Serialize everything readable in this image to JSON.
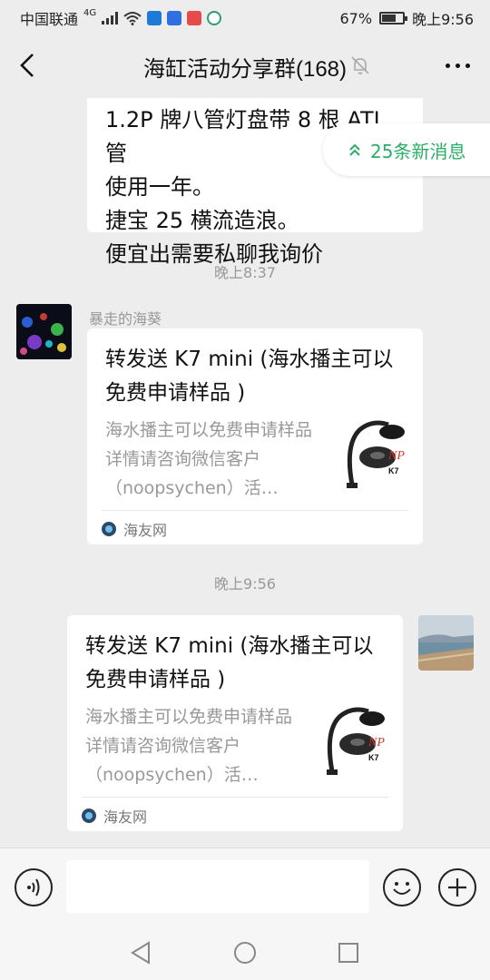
{
  "status_bar": {
    "carrier": "中国联通",
    "network": "4G",
    "battery": "67%",
    "time": "晚上9:56"
  },
  "header": {
    "title": "海缸活动分享群(168)"
  },
  "new_messages_pill": {
    "label": "25条新消息"
  },
  "messages": [
    {
      "type": "text",
      "lines": [
        "1.2P 牌八管灯盘带 8 根 ATI 管",
        "使用一年。",
        "捷宝 25 横流造浪。",
        "便宜出需要私聊我询价"
      ]
    },
    {
      "type": "timestamp",
      "text": "晚上8:37"
    },
    {
      "type": "link_card",
      "side": "left",
      "sender": "暴走的海葵",
      "title": "转发送 K7 mini (海水播主可以免费申请样品 )",
      "description": "海水播主可以免费申请样品详情请咨询微信客户（noopsychen）活…",
      "source": "海友网"
    },
    {
      "type": "timestamp",
      "text": "晚上9:56"
    },
    {
      "type": "link_card",
      "side": "right",
      "title": "转发送 K7 mini (海水播主可以免费申请样品 )",
      "description": "海水播主可以免费申请样品详情请咨询微信客户（noopsychen）活…",
      "source": "海友网"
    }
  ],
  "colors": {
    "background": "#ededed",
    "bubble": "#ffffff",
    "accent_green": "#2aae67",
    "timestamp": "#999999"
  }
}
